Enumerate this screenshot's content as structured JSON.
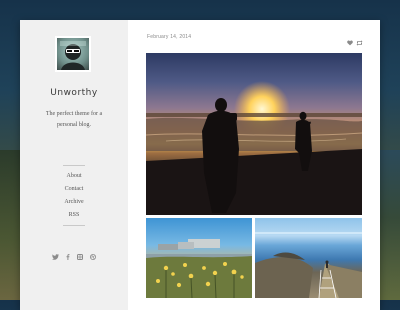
{
  "site": {
    "title": "Unworthy",
    "tagline": "The perfect theme for a personal blog."
  },
  "nav": {
    "items": [
      {
        "label": "About"
      },
      {
        "label": "Contact"
      },
      {
        "label": "Archive"
      },
      {
        "label": "RSS"
      }
    ]
  },
  "social": {
    "icons": [
      "twitter-icon",
      "facebook-icon",
      "instagram-icon",
      "dribbble-icon"
    ]
  },
  "post": {
    "date": "February 14, 2014",
    "action_icons": [
      "heart-icon",
      "reblog-icon"
    ],
    "images": [
      {
        "name": "sunset-beach-photo"
      },
      {
        "name": "wildflowers-photo"
      },
      {
        "name": "coastal-path-photo"
      }
    ]
  },
  "colors": {
    "sidebar_bg": "#f0f0f0",
    "card_bg": "#ffffff",
    "text_dark": "#3a3a3a",
    "text_muted": "#8a8a8a"
  }
}
